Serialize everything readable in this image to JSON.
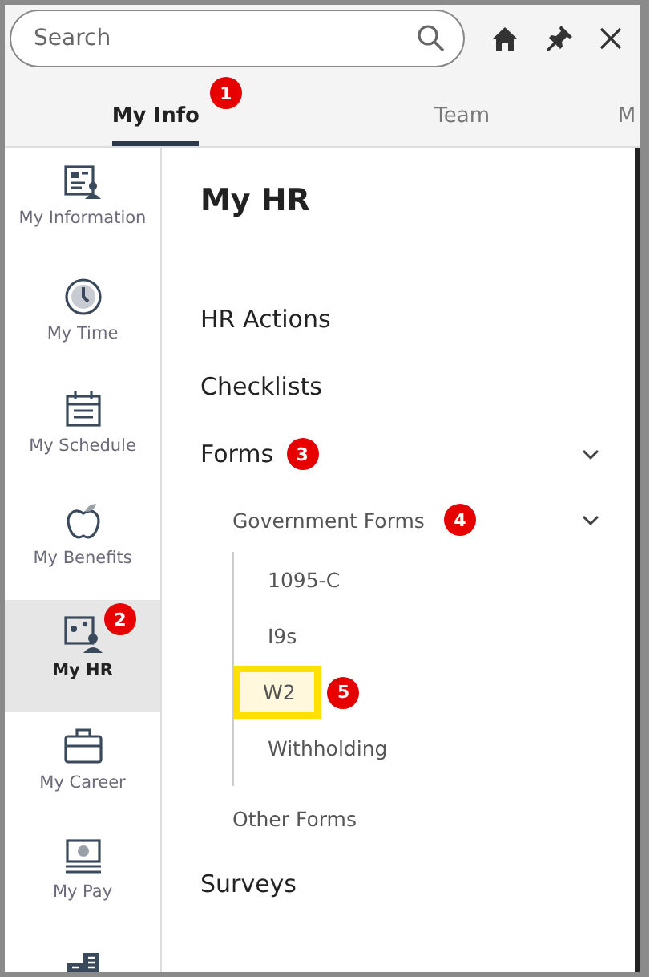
{
  "search": {
    "placeholder": "Search"
  },
  "tabs": [
    {
      "label": "My Info",
      "selected": true,
      "callout": "1"
    },
    {
      "label": "Team",
      "selected": false
    },
    {
      "label": "M",
      "selected": false
    }
  ],
  "sidebar": {
    "items": [
      {
        "label": "My Information",
        "selected": false
      },
      {
        "label": "My Time",
        "selected": false
      },
      {
        "label": "My Schedule",
        "selected": false
      },
      {
        "label": "My Benefits",
        "selected": false
      },
      {
        "label": "My HR",
        "selected": true,
        "callout": "2"
      },
      {
        "label": "My Career",
        "selected": false
      },
      {
        "label": "My Pay",
        "selected": false
      },
      {
        "selected": false
      }
    ]
  },
  "page_title": "My HR",
  "menu": [
    {
      "label": "HR Actions"
    },
    {
      "label": "Checklists"
    },
    {
      "label": "Forms",
      "expanded": true,
      "callout": "3",
      "children": [
        {
          "label": "Government Forms",
          "expanded": true,
          "callout": "4",
          "children": [
            {
              "label": "1095-C",
              "highlighted": false
            },
            {
              "label": "I9s",
              "highlighted": false
            },
            {
              "label": "W2",
              "highlighted": true,
              "callout": "5"
            },
            {
              "label": "Withholding",
              "highlighted": false
            }
          ]
        },
        {
          "label": "Other Forms"
        }
      ]
    },
    {
      "label": "Surveys"
    }
  ]
}
